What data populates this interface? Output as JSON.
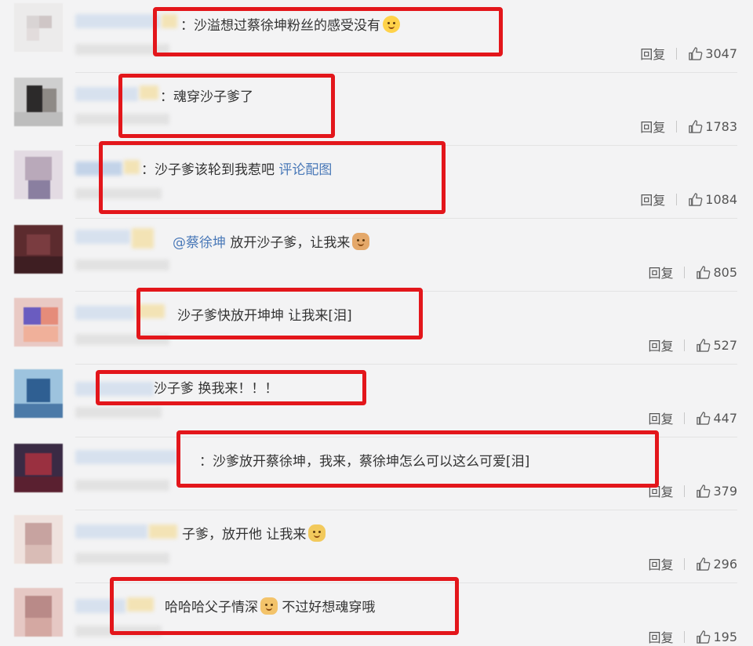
{
  "colors": {
    "highlight_box": "#e3161b",
    "link": "#4a79b8",
    "background": "#f3f3f4"
  },
  "reply_label": "回复",
  "comments": [
    {
      "prefix": "：",
      "body": "沙溢想过蔡徐坤粉丝的感受没有",
      "emoji": "smile-emoji",
      "likes": "3047"
    },
    {
      "prefix": "：",
      "body": "魂穿沙子爹了",
      "likes": "1783"
    },
    {
      "prefix": "：",
      "body": "沙子爹该轮到我惹吧",
      "link": "评论配图",
      "likes": "1084"
    },
    {
      "mention": "@蔡徐坤",
      "body": "放开沙子爹，让我来",
      "emoji": "dog-emoji",
      "likes": "805"
    },
    {
      "body": "沙子爹快放开坤坤 让我来[泪]",
      "likes": "527"
    },
    {
      "body": "沙子爹 换我来！！！",
      "likes": "447"
    },
    {
      "prefix": "：",
      "body": "沙爹放开蔡徐坤，我来，蔡徐坤怎么可以这么可爱[泪]",
      "likes": "379"
    },
    {
      "body": "子爹，放开他 让我来",
      "emoji": "face-emoji",
      "likes": "296"
    },
    {
      "body": "哈哈哈父子情深",
      "emoji": "cat-emoji",
      "body2": "不过好想魂穿哦",
      "likes": "195"
    }
  ]
}
